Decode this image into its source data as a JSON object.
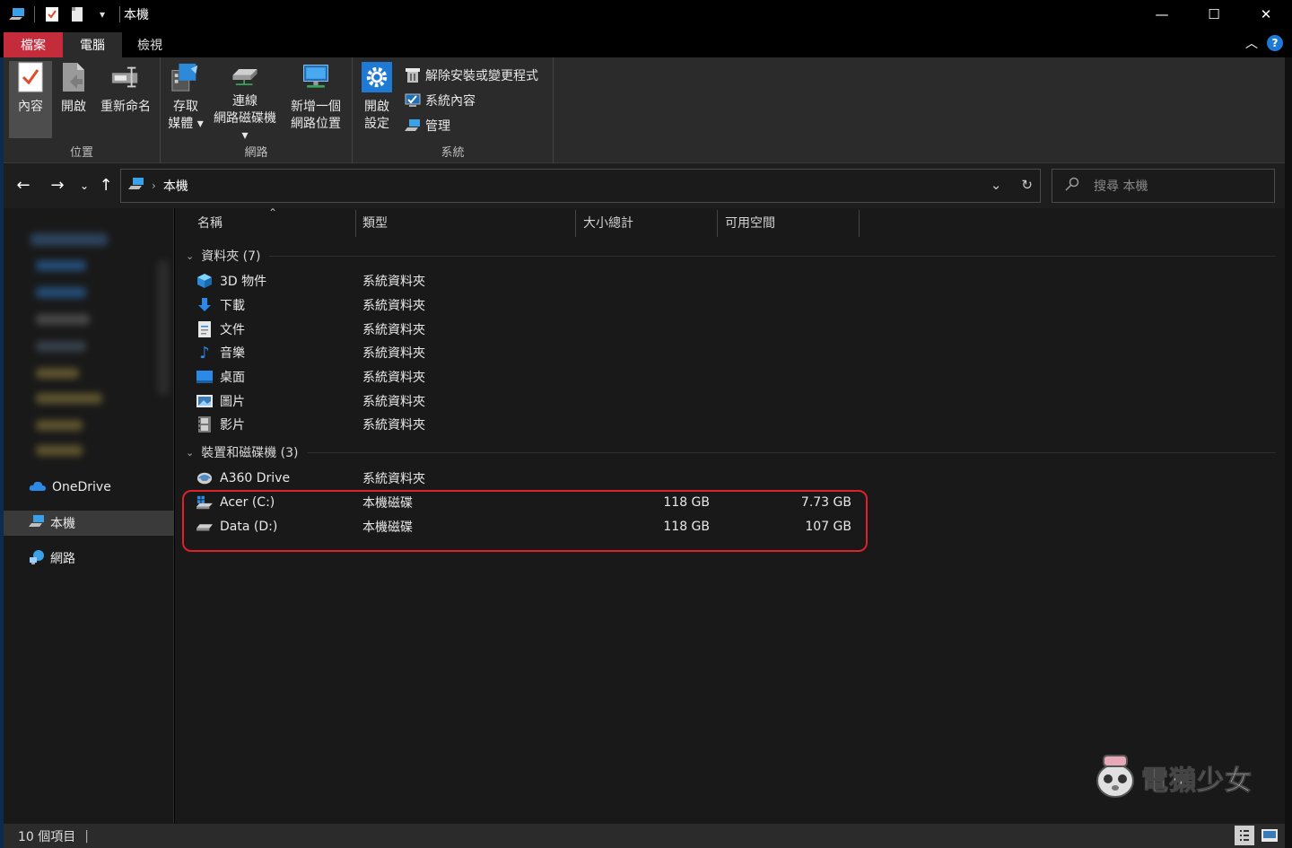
{
  "window": {
    "title": "本機",
    "minimize": "—",
    "maximize": "☐",
    "close": "✕"
  },
  "tabs": {
    "file": "檔案",
    "computer": "電腦",
    "view": "檢視"
  },
  "ribbon": {
    "location": {
      "label": "位置",
      "properties": "內容",
      "open": "開啟",
      "rename": "重新命名"
    },
    "network": {
      "label": "網路",
      "access_media_1": "存取",
      "access_media_2": "媒體 ▾",
      "map_drive_1": "連線",
      "map_drive_2": "網路磁碟機 ▾",
      "add_location_1": "新增一個",
      "add_location_2": "網路位置"
    },
    "system": {
      "label": "系統",
      "open_settings_1": "開啟",
      "open_settings_2": "設定",
      "uninstall": "解除安裝或變更程式",
      "system_properties": "系統內容",
      "manage": "管理"
    }
  },
  "address": {
    "crumb": "本機",
    "search_placeholder": "搜尋 本機"
  },
  "navpane": {
    "onedrive": "OneDrive",
    "this_pc": "本機",
    "network": "網路"
  },
  "columns": {
    "name": "名稱",
    "type": "類型",
    "total_size": "大小總計",
    "free_space": "可用空間"
  },
  "groups": {
    "folders": "資料夾 (7)",
    "devices": "裝置和磁碟機 (3)"
  },
  "folders": [
    {
      "name": "3D 物件",
      "type": "系統資料夾",
      "icon": "3d-objects-icon"
    },
    {
      "name": "下載",
      "type": "系統資料夾",
      "icon": "download-icon"
    },
    {
      "name": "文件",
      "type": "系統資料夾",
      "icon": "document-icon"
    },
    {
      "name": "音樂",
      "type": "系統資料夾",
      "icon": "music-icon"
    },
    {
      "name": "桌面",
      "type": "系統資料夾",
      "icon": "desktop-icon"
    },
    {
      "name": "圖片",
      "type": "系統資料夾",
      "icon": "pictures-icon"
    },
    {
      "name": "影片",
      "type": "系統資料夾",
      "icon": "video-icon"
    }
  ],
  "devices": [
    {
      "name": "A360 Drive",
      "type": "系統資料夾",
      "size": "",
      "free": ""
    },
    {
      "name": "Acer (C:)",
      "type": "本機磁碟",
      "size": "118 GB",
      "free": "7.73 GB"
    },
    {
      "name": "Data (D:)",
      "type": "本機磁碟",
      "size": "118 GB",
      "free": "107 GB"
    }
  ],
  "status": {
    "count": "10 個項目"
  },
  "watermark": "電獺少女",
  "colors": {
    "file_tab": "#c42b3b",
    "highlight_border": "#e0202a",
    "accent_blue": "#1f7ad6"
  }
}
